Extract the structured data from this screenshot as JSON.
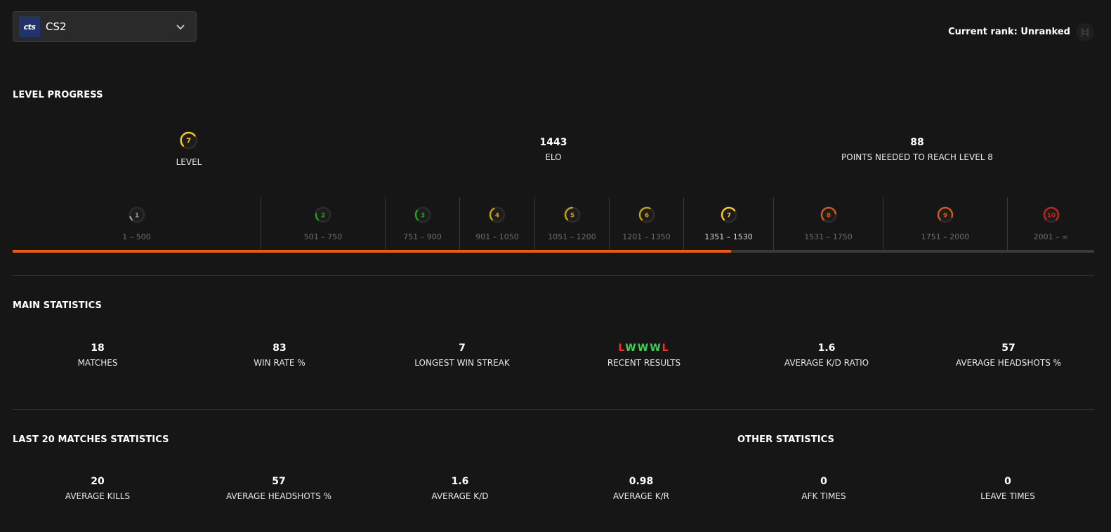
{
  "game_select": {
    "logo_text": "cts",
    "name": "CS2"
  },
  "current_rank": "Current rank: Unranked",
  "level_progress": {
    "title": "LEVEL PROGRESS",
    "level": {
      "value": "7",
      "label": "LEVEL"
    },
    "elo": {
      "value": "1443",
      "label": "ELO"
    },
    "points_needed": {
      "value": "88",
      "label": "POINTS NEEDED TO REACH LEVEL 8"
    },
    "progress_fraction": 0.664,
    "levels": [
      {
        "level": "1",
        "range": "1 – 500",
        "color": "#9a9a9a"
      },
      {
        "level": "2",
        "range": "501 – 750",
        "color": "#1ba51b"
      },
      {
        "level": "3",
        "range": "751 – 900",
        "color": "#1ba51b"
      },
      {
        "level": "4",
        "range": "901 – 1050",
        "color": "#c9a106"
      },
      {
        "level": "5",
        "range": "1051 – 1200",
        "color": "#c9a106"
      },
      {
        "level": "6",
        "range": "1201 – 1350",
        "color": "#c9a106"
      },
      {
        "level": "7",
        "range": "1351 – 1530",
        "color": "#ffcd00",
        "current": true
      },
      {
        "level": "8",
        "range": "1531 – 1750",
        "color": "#d45a1a"
      },
      {
        "level": "9",
        "range": "1751 – 2000",
        "color": "#d45a1a"
      },
      {
        "level": "10",
        "range": "2001 – ∞",
        "color": "#c4231a"
      }
    ]
  },
  "main_statistics": {
    "title": "MAIN STATISTICS",
    "items": [
      {
        "value": "18",
        "label": "MATCHES"
      },
      {
        "value": "83",
        "label": "WIN RATE %"
      },
      {
        "value": "7",
        "label": "LONGEST WIN STREAK"
      },
      {
        "value": "",
        "label": "RECENT RESULTS"
      },
      {
        "value": "1.6",
        "label": "AVERAGE K/D RATIO"
      },
      {
        "value": "57",
        "label": "AVERAGE HEADSHOTS %"
      }
    ],
    "recent_results": [
      "L",
      "W",
      "W",
      "W",
      "L"
    ]
  },
  "last20": {
    "title": "LAST 20 MATCHES STATISTICS",
    "items": [
      {
        "value": "20",
        "label": "AVERAGE KILLS"
      },
      {
        "value": "57",
        "label": "AVERAGE HEADSHOTS %"
      },
      {
        "value": "1.6",
        "label": "AVERAGE K/D"
      },
      {
        "value": "0.98",
        "label": "AVERAGE K/R"
      }
    ]
  },
  "other": {
    "title": "OTHER STATISTICS",
    "items": [
      {
        "value": "0",
        "label": "AFK TIMES"
      },
      {
        "value": "0",
        "label": "LEAVE TIMES"
      }
    ]
  },
  "colors": {
    "accent": "#ff5500",
    "background": "#161616",
    "loss": "#ff2b2b",
    "win": "#3ad34b"
  }
}
